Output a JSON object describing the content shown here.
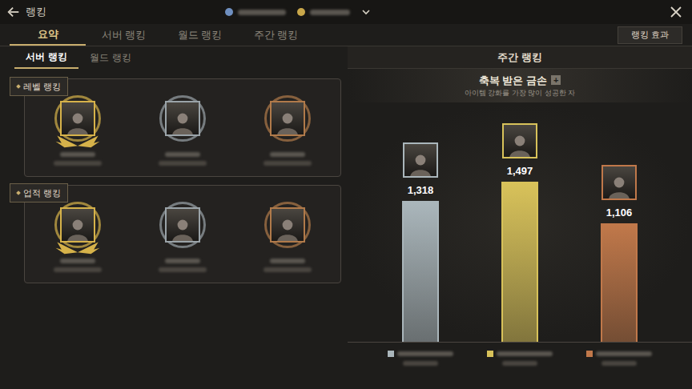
{
  "window": {
    "title": "랭킹"
  },
  "tabs": [
    {
      "label": "요약",
      "selected": true
    },
    {
      "label": "서버 랭킹",
      "selected": false
    },
    {
      "label": "월드 랭킹",
      "selected": false
    },
    {
      "label": "주간 랭킹",
      "selected": false
    }
  ],
  "effect_button": "랭킹 효과",
  "sub_tabs": [
    {
      "label": "서버 랭킹",
      "selected": true
    },
    {
      "label": "월드 랭킹",
      "selected": false
    }
  ],
  "sections": [
    {
      "title": "레벨 랭킹",
      "entries": [
        {
          "color": "#d6b24a",
          "winged": true
        },
        {
          "color": "#9aa3a8",
          "winged": false
        },
        {
          "color": "#b07a4a",
          "winged": false
        }
      ]
    },
    {
      "title": "업적 랭킹",
      "entries": [
        {
          "color": "#d6b24a",
          "winged": true
        },
        {
          "color": "#9aa3a8",
          "winged": false
        },
        {
          "color": "#b07a4a",
          "winged": false
        }
      ]
    }
  ],
  "weekly": {
    "header": "주간 랭킹",
    "title": "축복 받은 금손",
    "title_icon": "+",
    "subtitle": "아이템 강화를 가장 많이 성공한 자",
    "bars": [
      {
        "value": "1,318",
        "level": 0.88,
        "color": "#aab6bb"
      },
      {
        "value": "1,497",
        "level": 1,
        "color": "#d8c25a"
      },
      {
        "value": "1,106",
        "level": 0.74,
        "color": "#c0784a"
      }
    ]
  }
}
